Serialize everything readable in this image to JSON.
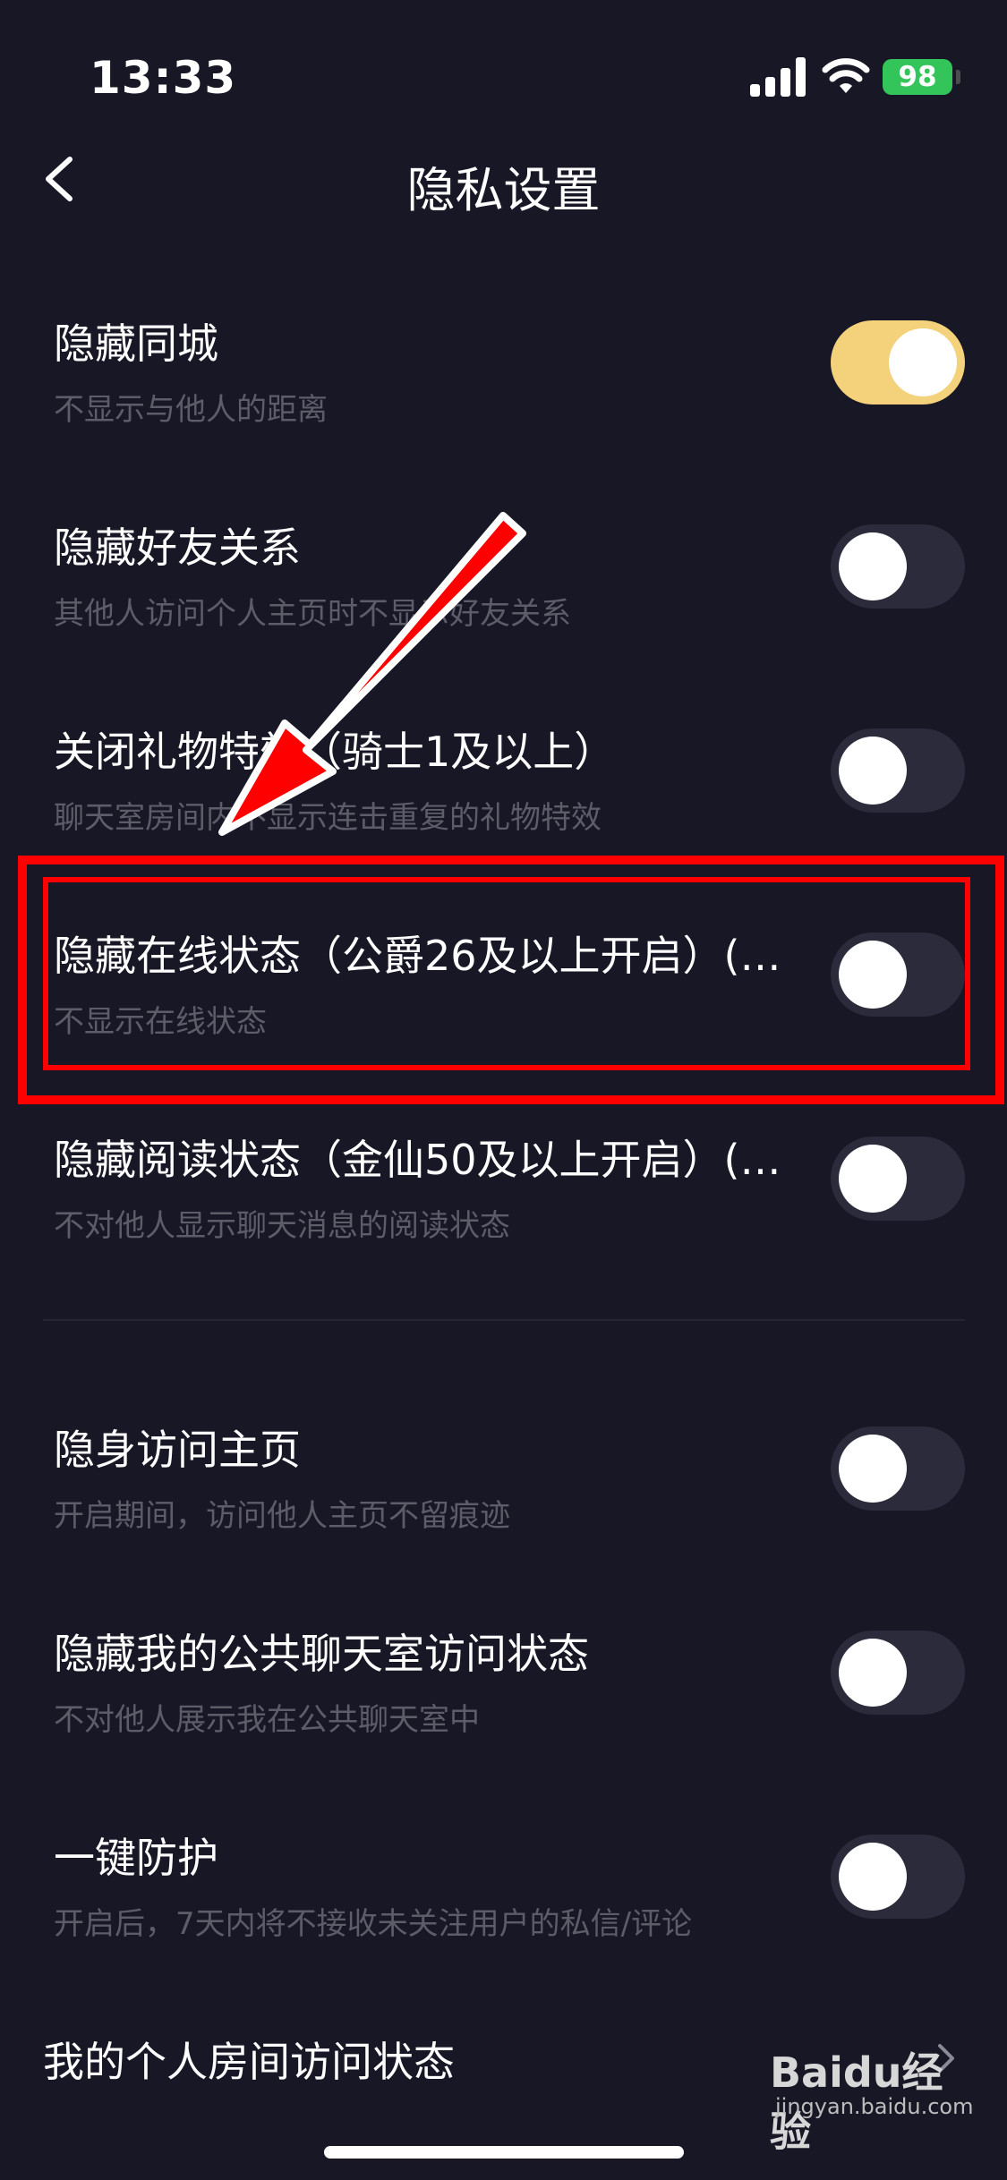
{
  "status_bar": {
    "time": "13:33",
    "battery": "98"
  },
  "nav": {
    "title": "隐私设置"
  },
  "settings": [
    {
      "title": "隐藏同城",
      "subtitle": "不显示与他人的距离",
      "on": true
    },
    {
      "title": "隐藏好友关系",
      "subtitle": "其他人访问个人主页时不显示好友关系",
      "on": false
    },
    {
      "title": "关闭礼物特效（骑士1及以上）",
      "subtitle": "聊天室房间内不显示连击重复的礼物特效",
      "on": false
    },
    {
      "title": "隐藏在线状态（公爵26及以上开启）(…",
      "subtitle": "不显示在线状态",
      "on": false
    },
    {
      "title": "隐藏阅读状态（金仙50及以上开启）(…",
      "subtitle": "不对他人显示聊天消息的阅读状态",
      "on": false
    },
    {
      "title": "隐身访问主页",
      "subtitle": "开启期间，访问他人主页不留痕迹",
      "on": false
    },
    {
      "title": "隐藏我的公共聊天室访问状态",
      "subtitle": "不对他人展示我在公共聊天室中",
      "on": false
    },
    {
      "title": "一键防护",
      "subtitle": "开启后，7天内将不接收未关注用户的私信/评论",
      "on": false
    }
  ],
  "link": {
    "label": "我的个人房间访问状态"
  },
  "watermark": {
    "brand": "Baidu经验",
    "sub": "jingyan.baidu.com"
  },
  "colors": {
    "background": "#181726",
    "toggle_on": "#f4d27c",
    "toggle_off": "#2c2b3b",
    "annotation": "#ff0000"
  }
}
